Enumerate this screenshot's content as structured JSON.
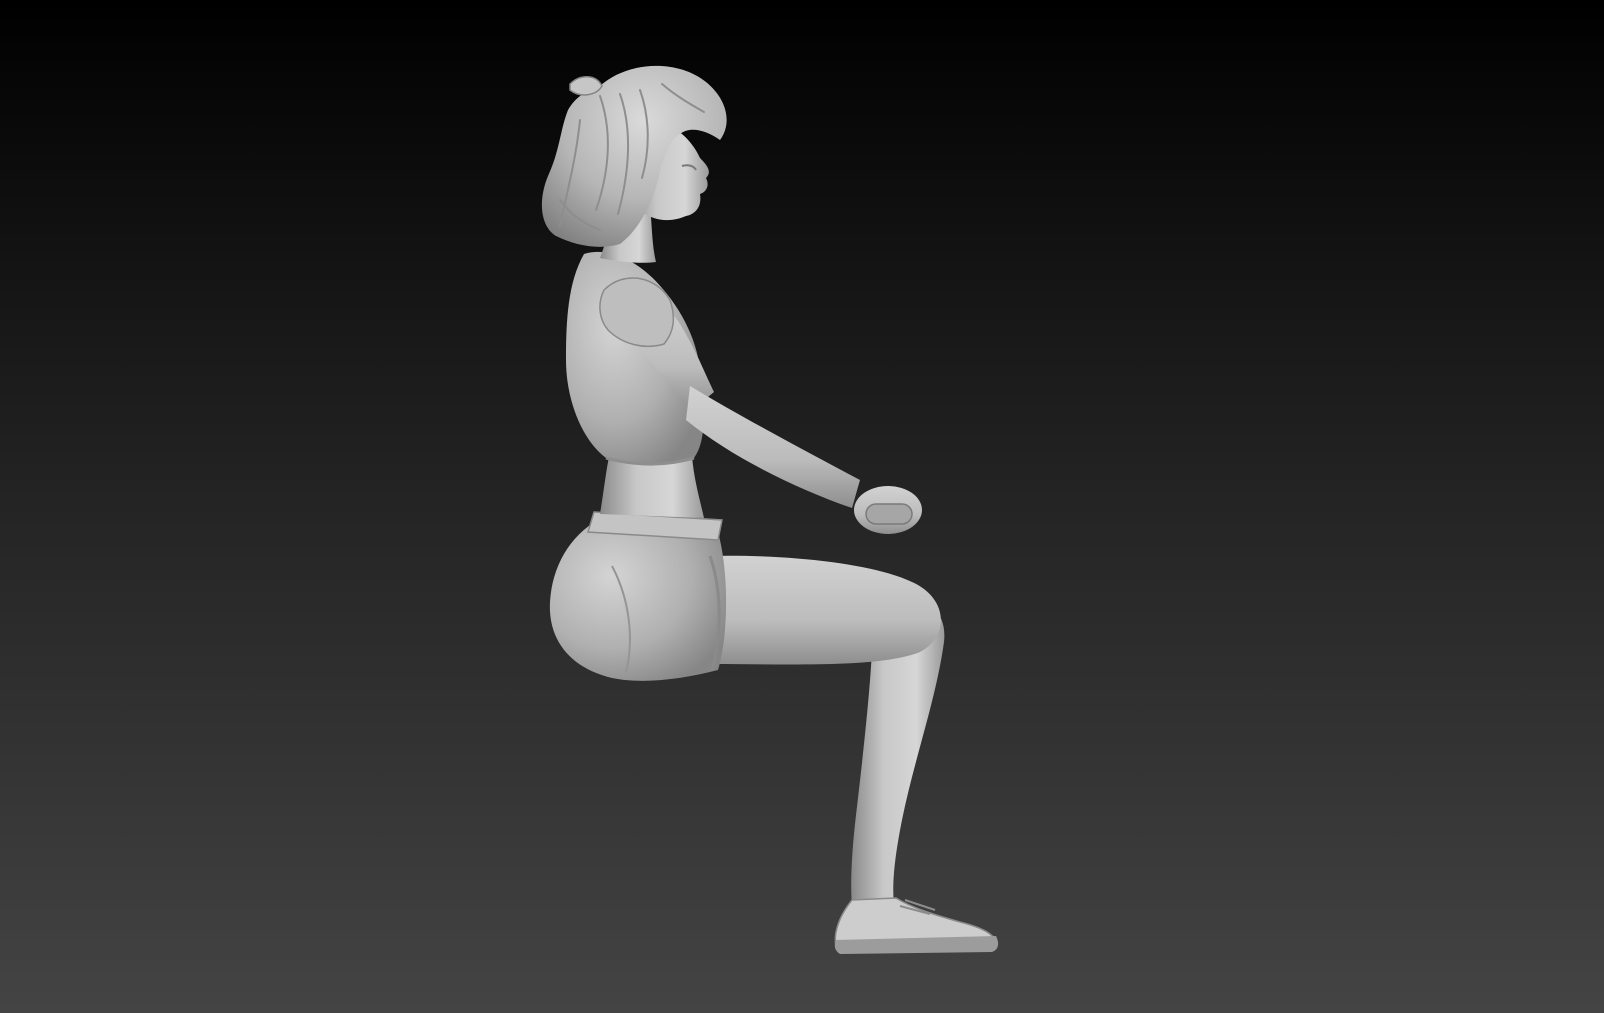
{
  "scene": {
    "subject": "seated-figure-sculpt",
    "background": {
      "top_color": "#000000",
      "bottom_color": "#444444"
    },
    "material_colors": {
      "highlight": "#dcdcdc",
      "midtone": "#b4b4b4",
      "shadow": "#7c7c7c"
    }
  }
}
